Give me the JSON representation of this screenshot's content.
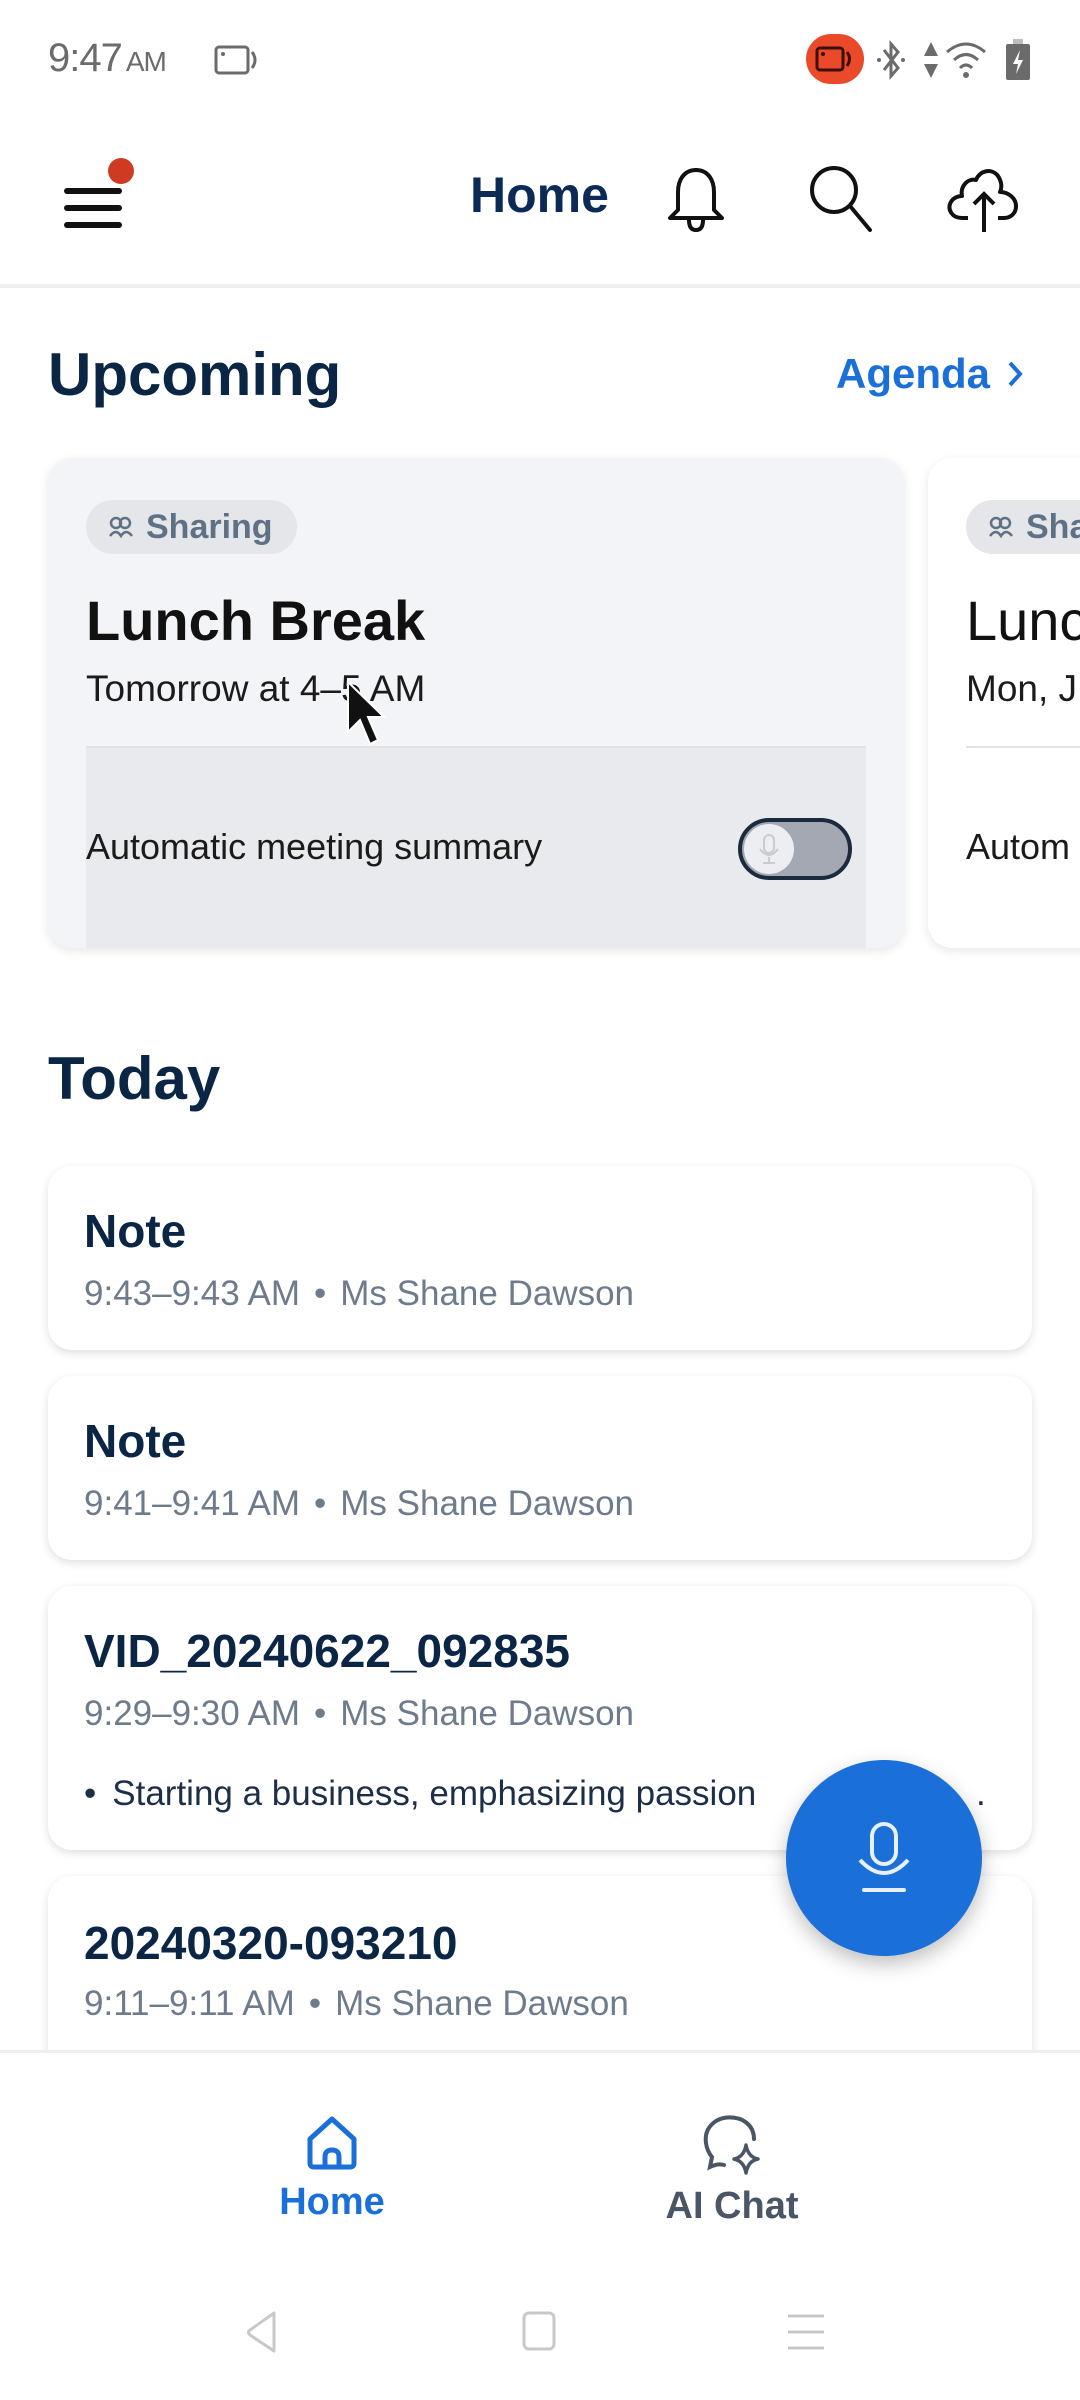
{
  "status_bar": {
    "time": "9:47",
    "ampm": "AM",
    "icons": [
      "screen-record-icon",
      "recording-indicator-icon",
      "bluetooth-icon",
      "data-arrows-icon",
      "wifi-icon",
      "battery-charging-icon"
    ],
    "recording_color": "#ea4a2a"
  },
  "app_bar": {
    "title": "Home",
    "icons": [
      "menu-icon",
      "bell-icon",
      "search-icon",
      "cloud-upload-icon"
    ],
    "menu_badge_color": "#cf3b22"
  },
  "upcoming": {
    "title": "Upcoming",
    "agenda_link": "Agenda",
    "cards": [
      {
        "chip": "Sharing",
        "title": "Lunch Break",
        "time": "Tomorrow at 4–5 AM",
        "summary_label": "Automatic meeting summary",
        "summary_enabled": false
      },
      {
        "chip": "Sha",
        "title": "Lunc",
        "time": "Mon, J",
        "summary_label": "Autom"
      }
    ]
  },
  "today": {
    "title": "Today",
    "items": [
      {
        "title": "Note",
        "time": "9:43–9:43 AM",
        "owner": "Ms Shane Dawson"
      },
      {
        "title": "Note",
        "time": "9:41–9:41 AM",
        "owner": "Ms Shane Dawson"
      },
      {
        "title": "VID_20240622_092835",
        "time": "9:29–9:30 AM",
        "owner": "Ms Shane Dawson",
        "summary": "Starting a business, emphasizing passion",
        "summary_tail": "."
      },
      {
        "title": "20240320-093210",
        "time": "9:11–9:11 AM",
        "owner": "Ms Shane Dawson"
      }
    ],
    "separator": "•"
  },
  "fab": {
    "icon": "microphone-icon",
    "color": "#1a6fd8"
  },
  "bottom_nav": {
    "items": [
      {
        "label": "Home",
        "icon": "home-icon",
        "active": true
      },
      {
        "label": "AI Chat",
        "icon": "ai-chat-icon",
        "active": false
      }
    ],
    "active_color": "#1a6fd8",
    "inactive_color": "#4a5566"
  },
  "system_nav": {
    "buttons": [
      "back",
      "home",
      "recents"
    ]
  }
}
